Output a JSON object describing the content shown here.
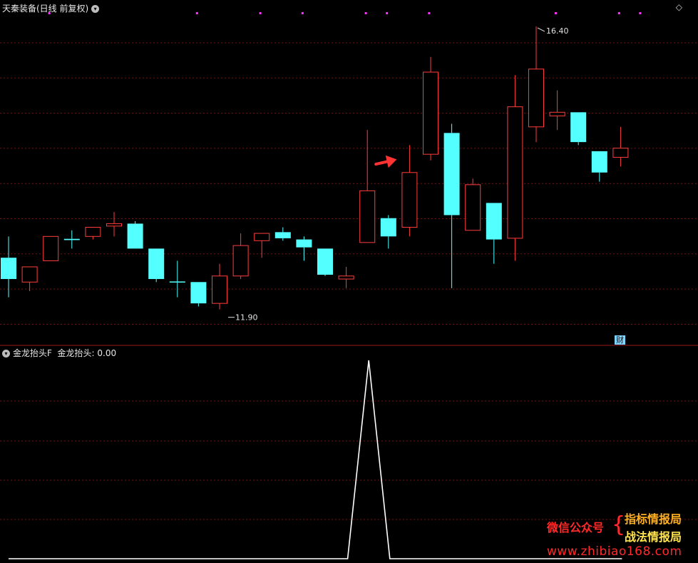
{
  "header": {
    "main_title": "天秦装备(日线 前复权)",
    "sub_title": "金龙抬头F",
    "sub_value": "金龙抬头: 0.00",
    "diamond": "◇",
    "badge": "财"
  },
  "watermark": {
    "left": "微信公众号",
    "brace": "{",
    "right_top": "指标情报局",
    "right_bottom": "战法情报局",
    "url": "www.zhibiao168.com"
  },
  "colors": {
    "background": "#000000",
    "up_candle": "#ff3c3c",
    "down_candle": "#54ffff",
    "grid": "#7a1010",
    "divider": "#a01818",
    "indicator_line": "#ffffff",
    "marker": "#ff33ff",
    "arrow": "#ff3333"
  },
  "chart_data": [
    {
      "type": "candlestick",
      "title": "天秦装备(日线 前复权)",
      "price_range": [
        11.5,
        16.6
      ],
      "candles": [
        {
          "o": 12.6,
          "c": 12.25,
          "h": 12.95,
          "l": 11.95
        },
        {
          "o": 12.2,
          "c": 12.45,
          "h": 12.45,
          "l": 12.05
        },
        {
          "o": 12.55,
          "c": 12.95,
          "h": 12.95,
          "l": 12.55
        },
        {
          "o": 12.91,
          "c": 12.89,
          "h": 13.05,
          "l": 12.75
        },
        {
          "o": 12.95,
          "c": 13.1,
          "h": 13.1,
          "l": 12.9
        },
        {
          "o": 13.12,
          "c": 13.16,
          "h": 13.35,
          "l": 12.95
        },
        {
          "o": 13.16,
          "c": 12.75,
          "h": 13.2,
          "l": 12.75
        },
        {
          "o": 12.75,
          "c": 12.25,
          "h": 12.75,
          "l": 12.2
        },
        {
          "o": 12.21,
          "c": 12.2,
          "h": 12.55,
          "l": 11.95
        },
        {
          "o": 12.2,
          "c": 11.85,
          "h": 12.2,
          "l": 11.8
        },
        {
          "o": 11.85,
          "c": 12.3,
          "h": 12.5,
          "l": 11.75
        },
        {
          "o": 12.3,
          "c": 12.8,
          "h": 13.0,
          "l": 12.25
        },
        {
          "o": 12.88,
          "c": 13.0,
          "h": 13.0,
          "l": 12.6
        },
        {
          "o": 13.02,
          "c": 12.92,
          "h": 13.1,
          "l": 12.88
        },
        {
          "o": 12.9,
          "c": 12.77,
          "h": 12.95,
          "l": 12.55
        },
        {
          "o": 12.75,
          "c": 12.32,
          "h": 12.75,
          "l": 12.3
        },
        {
          "o": 12.25,
          "c": 12.3,
          "h": 12.45,
          "l": 12.1
        },
        {
          "o": 12.85,
          "c": 13.7,
          "h": 14.7,
          "l": 12.85
        },
        {
          "o": 13.25,
          "c": 12.95,
          "h": 13.3,
          "l": 12.75
        },
        {
          "o": 13.1,
          "c": 14.0,
          "h": 14.45,
          "l": 12.95
        },
        {
          "o": 14.3,
          "c": 15.65,
          "h": 15.9,
          "l": 14.2
        },
        {
          "o": 14.65,
          "c": 13.3,
          "h": 14.8,
          "l": 12.1
        },
        {
          "o": 13.05,
          "c": 13.8,
          "h": 13.9,
          "l": 13.05
        },
        {
          "o": 13.5,
          "c": 12.9,
          "h": 13.5,
          "l": 12.5
        },
        {
          "o": 12.92,
          "c": 15.08,
          "h": 15.6,
          "l": 12.55
        },
        {
          "o": 14.75,
          "c": 15.7,
          "h": 16.4,
          "l": 14.5
        },
        {
          "o": 14.93,
          "c": 14.99,
          "h": 15.35,
          "l": 14.7
        },
        {
          "o": 14.99,
          "c": 14.5,
          "h": 14.99,
          "l": 14.45
        },
        {
          "o": 14.35,
          "c": 14.0,
          "h": 14.35,
          "l": 13.85
        },
        {
          "o": 14.25,
          "c": 14.4,
          "h": 14.75,
          "l": 14.1
        }
      ],
      "markers": {
        "high_label": "16.40",
        "low_label": "11.90",
        "high_index": 25,
        "low_index": 10
      },
      "top_dot_indices": [
        1,
        8,
        11,
        13,
        16,
        17,
        19,
        25,
        28,
        29
      ],
      "arrow": {
        "from_index": 17,
        "to_index": 19
      }
    },
    {
      "type": "line",
      "title": "金龙抬头F",
      "series": [
        {
          "name": "金龙抬头",
          "values": [
            0,
            0,
            0,
            0,
            0,
            0,
            0,
            0,
            0,
            0,
            0,
            0,
            0,
            0,
            0,
            0,
            0,
            1,
            0,
            0,
            0,
            0,
            0,
            0,
            0,
            0,
            0,
            0,
            0,
            0
          ]
        }
      ],
      "ylim": [
        0,
        1
      ]
    }
  ]
}
